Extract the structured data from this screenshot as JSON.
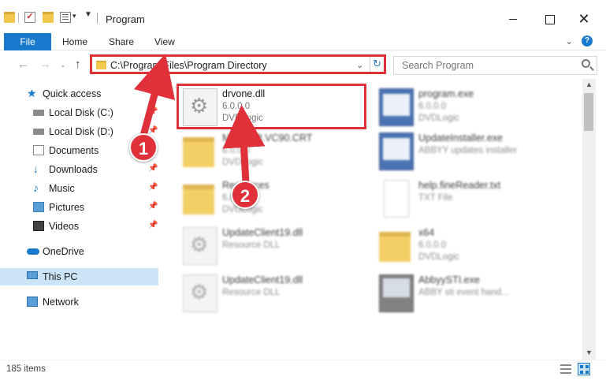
{
  "window": {
    "title": "Program"
  },
  "ribbon": {
    "tabs": [
      "File",
      "Home",
      "Share",
      "View"
    ],
    "help": "?"
  },
  "address": {
    "path": "C:\\Program Files\\Program Directory",
    "search_placeholder": "Search Program"
  },
  "nav_pane": {
    "items": [
      {
        "label": "Quick access",
        "icon": "star-icon"
      },
      {
        "label": "Local Disk (C:)",
        "icon": "disk-icon",
        "pinned": true
      },
      {
        "label": "Local Disk (D:)",
        "icon": "disk-icon",
        "pinned": true
      },
      {
        "label": "Documents",
        "icon": "documents-icon",
        "pinned": true
      },
      {
        "label": "Downloads",
        "icon": "download-icon",
        "pinned": true
      },
      {
        "label": "Music",
        "icon": "music-icon",
        "pinned": true
      },
      {
        "label": "Pictures",
        "icon": "pictures-icon",
        "pinned": true
      },
      {
        "label": "Videos",
        "icon": "videos-icon",
        "pinned": true
      },
      {
        "label": "OneDrive",
        "icon": "onedrive-icon"
      },
      {
        "label": "This PC",
        "icon": "pc-icon",
        "selected": true
      },
      {
        "label": "Network",
        "icon": "network-icon"
      }
    ]
  },
  "files": [
    {
      "name": "drvone.dll",
      "meta1": "6.0.0.0",
      "meta2": "DVDLogic",
      "icon": "gear-file-icon"
    },
    {
      "name": "program.exe",
      "meta1": "6.0.0.0",
      "meta2": "DVDLogic",
      "icon": "exe-icon"
    },
    {
      "name": "Microsoft.VC90.CRT",
      "meta1": "6.0.0.0",
      "meta2": "DVDLogic",
      "icon": "folder-icon"
    },
    {
      "name": "UpdateInstaller.exe",
      "meta1": "ABBYY updates installer",
      "meta2": "",
      "icon": "exe-icon"
    },
    {
      "name": "Resources",
      "meta1": "6.0.0.0",
      "meta2": "DVDLogic",
      "icon": "folder-icon"
    },
    {
      "name": "help.fineReader.txt",
      "meta1": "TXT File",
      "meta2": "",
      "icon": "text-file-icon"
    },
    {
      "name": "UpdateClient19.dll",
      "meta1": "Resource DLL",
      "meta2": "",
      "icon": "gear-file-icon"
    },
    {
      "name": "x64",
      "meta1": "6.0.0.0",
      "meta2": "DVDLogic",
      "icon": "folder-icon"
    },
    {
      "name": "UpdateClient19.dll",
      "meta1": "Resource DLL",
      "meta2": "",
      "icon": "gear-file-icon"
    },
    {
      "name": "AbbyySTI.exe",
      "meta1": "ABBY sti event hand...",
      "meta2": "",
      "icon": "app-icon"
    }
  ],
  "callouts": [
    "1",
    "2"
  ],
  "status": {
    "count": "185 items"
  },
  "colors": {
    "accent": "#1979ca",
    "highlight": "#e0303a",
    "selected": "#cce4f7"
  }
}
